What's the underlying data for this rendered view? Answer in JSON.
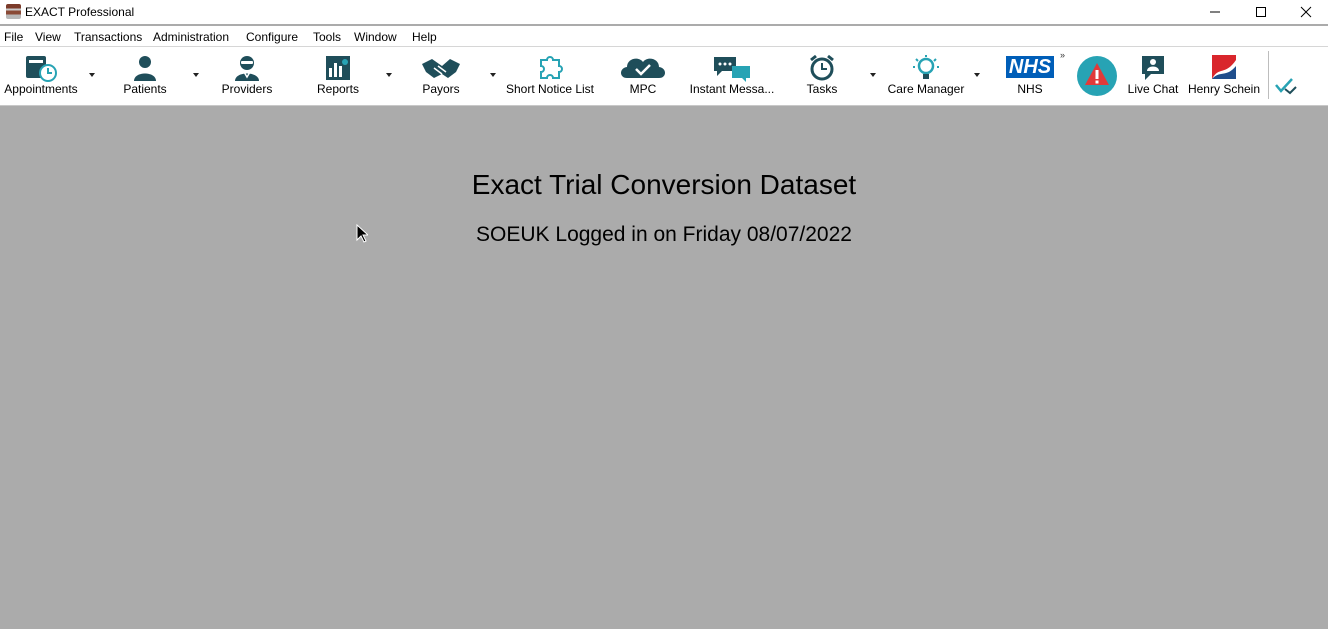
{
  "window": {
    "title": "EXACT Professional",
    "controls": [
      "minimize",
      "maximize",
      "close"
    ]
  },
  "menu": {
    "items": [
      "File",
      "View",
      "Transactions",
      "Administration",
      "Configure",
      "Tools",
      "Window",
      "Help"
    ]
  },
  "toolbar": {
    "accent_color": "#1f4e5a",
    "nhs_color": "#005eb8",
    "alert_color": "#27a3b4",
    "buttons": [
      {
        "label": "Appointments",
        "icon": "appointments-icon",
        "dropdown": true
      },
      {
        "label": "Patients",
        "icon": "patient-icon",
        "dropdown": true
      },
      {
        "label": "Providers",
        "icon": "provider-icon",
        "dropdown": false
      },
      {
        "label": "Reports",
        "icon": "reports-icon",
        "dropdown": true
      },
      {
        "label": "Payors",
        "icon": "handshake-icon",
        "dropdown": true
      },
      {
        "label": "Short Notice List",
        "icon": "puzzle-icon",
        "dropdown": false
      },
      {
        "label": "MPC",
        "icon": "cloud-check-icon",
        "dropdown": false
      },
      {
        "label": "Instant Messa...",
        "icon": "chat-bubbles-icon",
        "dropdown": false
      },
      {
        "label": "Tasks",
        "icon": "alarm-clock-icon",
        "dropdown": true
      },
      {
        "label": "Care Manager",
        "icon": "lightbulb-icon",
        "dropdown": true
      },
      {
        "label": "NHS",
        "icon": "nhs-logo-icon",
        "dropdown": false
      },
      {
        "label": "",
        "icon": "alert-icon",
        "dropdown": false
      },
      {
        "label": "Live Chat",
        "icon": "live-chat-icon",
        "dropdown": false
      },
      {
        "label": "Henry Schein",
        "icon": "henry-schein-logo-icon",
        "dropdown": false
      }
    ],
    "nhs_logo_text": "NHS",
    "overflow": "»"
  },
  "main": {
    "title": "Exact Trial Conversion Dataset",
    "login_status": "SOEUK Logged in on Friday 08/07/2022"
  }
}
